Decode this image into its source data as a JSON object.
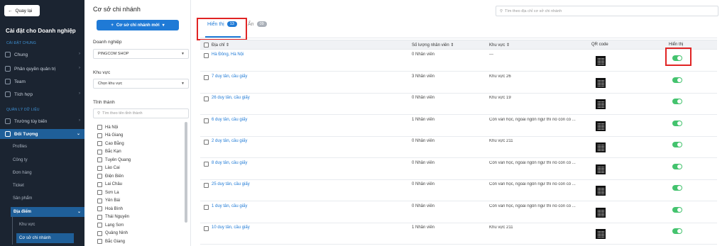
{
  "sidebar": {
    "back_label": "Quay lại",
    "title": "Cài đặt cho Doanh nghiệp",
    "section_general": "CÀI ĐẶT CHUNG",
    "items_general": [
      {
        "label": "Chung",
        "icon": "grid-icon"
      },
      {
        "label": "Phân quyền quản trị",
        "icon": "shield-icon"
      },
      {
        "label": "Team",
        "icon": "team-icon"
      },
      {
        "label": "Tích hợp",
        "icon": "plugin-icon"
      }
    ],
    "section_data": "QUẢN LÝ DỮ LIỆU",
    "custom_fields": "Trường tùy biến",
    "objects": "Đối Tượng",
    "object_items": [
      "Profiles",
      "Công ty",
      "Đơn hàng",
      "Ticket",
      "Sản phẩm"
    ],
    "location": "Địa điểm",
    "location_items": [
      "Khu vực",
      "Cơ sở chi nhánh"
    ]
  },
  "filter": {
    "title": "Cơ sở chi nhánh",
    "new_button": "Cơ sở chi nhánh mới",
    "company_label": "Doanh nghiệp",
    "company_value": "PINGCOM SHOP",
    "region_label": "Khu vực",
    "region_placeholder": "Chọn khu vực",
    "province_label": "Tỉnh thành",
    "province_search_placeholder": "Tìm theo tên tỉnh thành",
    "provinces": [
      "Hà Nội",
      "Hà Giang",
      "Cao Bằng",
      "Bắc Kạn",
      "Tuyên Quang",
      "Lào Cai",
      "Điện Biên",
      "Lai Châu",
      "Sơn La",
      "Yên Bái",
      "Hoà Bình",
      "Thái Nguyên",
      "Lạng Sơn",
      "Quảng Ninh",
      "Bắc Giang"
    ]
  },
  "main": {
    "search_placeholder": "Tìm theo địa chỉ cơ sở chi nhánh",
    "tabs": [
      {
        "label": "Hiển thị",
        "count": "13"
      },
      {
        "label": "Ẩn",
        "count": "09"
      }
    ],
    "columns": [
      "Địa chỉ",
      "Số lượng nhân viên",
      "Khu vực",
      "QR code",
      "Hiển thị"
    ],
    "rows": [
      {
        "address": "Hà Đông, Hà Nội",
        "employees": "0 Nhân viên",
        "area": "---"
      },
      {
        "address": "7 duy tân, cầu giấy",
        "employees": "3 Nhân viên",
        "area": "Khu vực 26"
      },
      {
        "address": "26 duy tân, cầu giấy",
        "employees": "0 Nhân viên",
        "area": "Khu vực 19"
      },
      {
        "address": "6 duy tân, cầu giấy",
        "employees": "1 Nhân viên",
        "area": "Còn văn học, ngoài ngôn ngữ thì nó còn có ..."
      },
      {
        "address": "2 duy tân, cầu giấy",
        "employees": "0 Nhân viên",
        "area": "Khu vực 211"
      },
      {
        "address": "8 duy tân, cầu giấy",
        "employees": "0 Nhân viên",
        "area": "Còn văn học, ngoài ngôn ngữ thì nó còn có ..."
      },
      {
        "address": "25 duy tân, cầu giấy",
        "employees": "0 Nhân viên",
        "area": "Còn văn học, ngoài ngôn ngữ thì nó còn có ..."
      },
      {
        "address": "1 duy tân, cầu giấy",
        "employees": "0 Nhân viên",
        "area": "Còn văn học, ngoài ngôn ngữ thì nó còn có ..."
      },
      {
        "address": "10 duy tân, cầu giấy",
        "employees": "1 Nhân viên",
        "area": "Khu vực 211"
      }
    ]
  },
  "colors": {
    "accent": "#1f7ad6",
    "sidebar_bg": "#1b2431",
    "toggle_on": "#44c36e",
    "highlight": "#e02424"
  }
}
